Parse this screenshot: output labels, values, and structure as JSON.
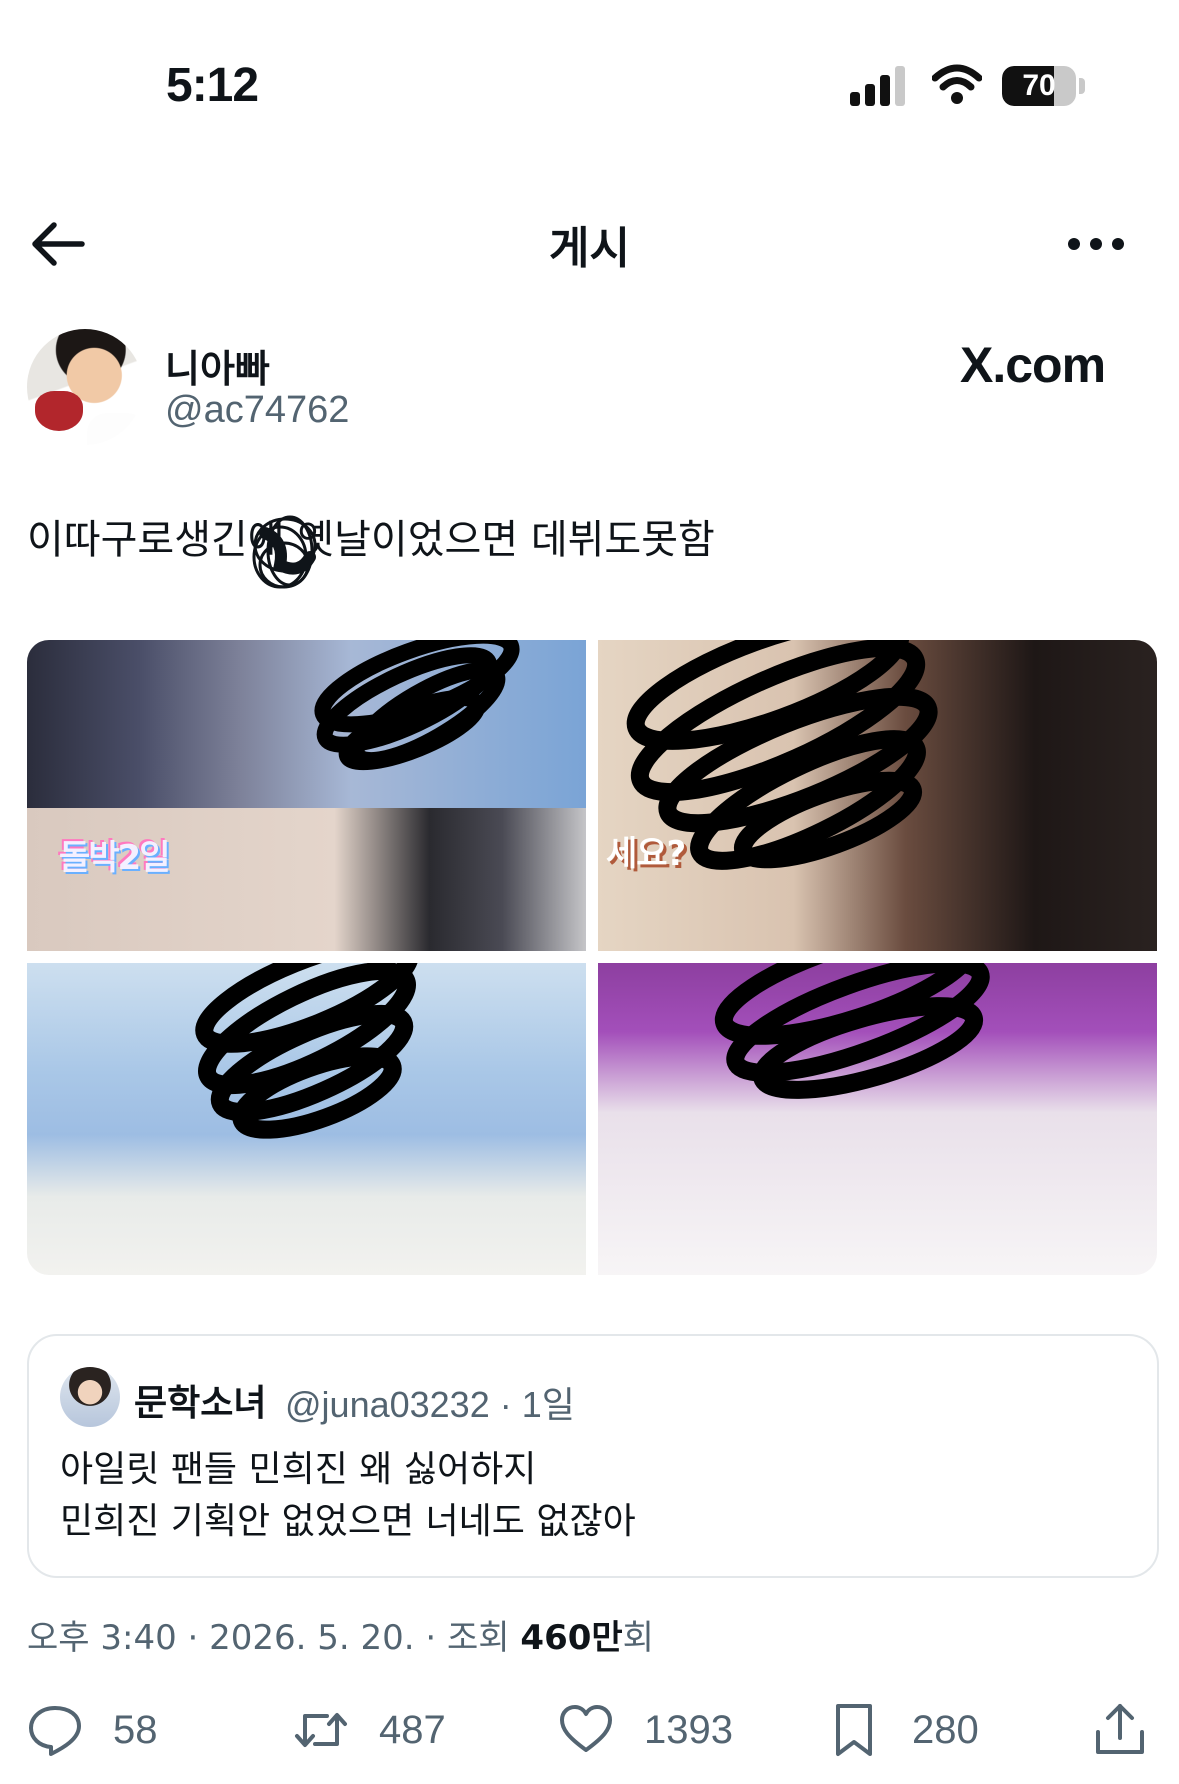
{
  "status_bar": {
    "time": "5:12",
    "battery": "70",
    "battery_level": 0.7
  },
  "nav": {
    "title": "게시"
  },
  "author": {
    "name": "니아빠",
    "handle": "@ac74762",
    "source": "X.com"
  },
  "tweet": {
    "text": "이따구로생긴애 옛날이었으면 데뷔도못함"
  },
  "media": {
    "captions": [
      "돌박2일",
      "세요?"
    ]
  },
  "quote": {
    "name": "문학소녀",
    "meta": "@juna03232 · 1일",
    "line1": "아일릿 팬들 민희진 왜 싫어하지",
    "line2": "민희진 기획안 없었으면 너네도 없잖아"
  },
  "meta": {
    "prefix": "오후 3:40 · 2026. 5. 20. · 조회 ",
    "views": "460만",
    "suffix": "회"
  },
  "actions": {
    "replies": "58",
    "reposts": "487",
    "likes": "1393",
    "bookmarks": "280"
  },
  "colors": {
    "text": "#0f1419",
    "secondary": "#536471",
    "border": "#e3e7ea"
  }
}
